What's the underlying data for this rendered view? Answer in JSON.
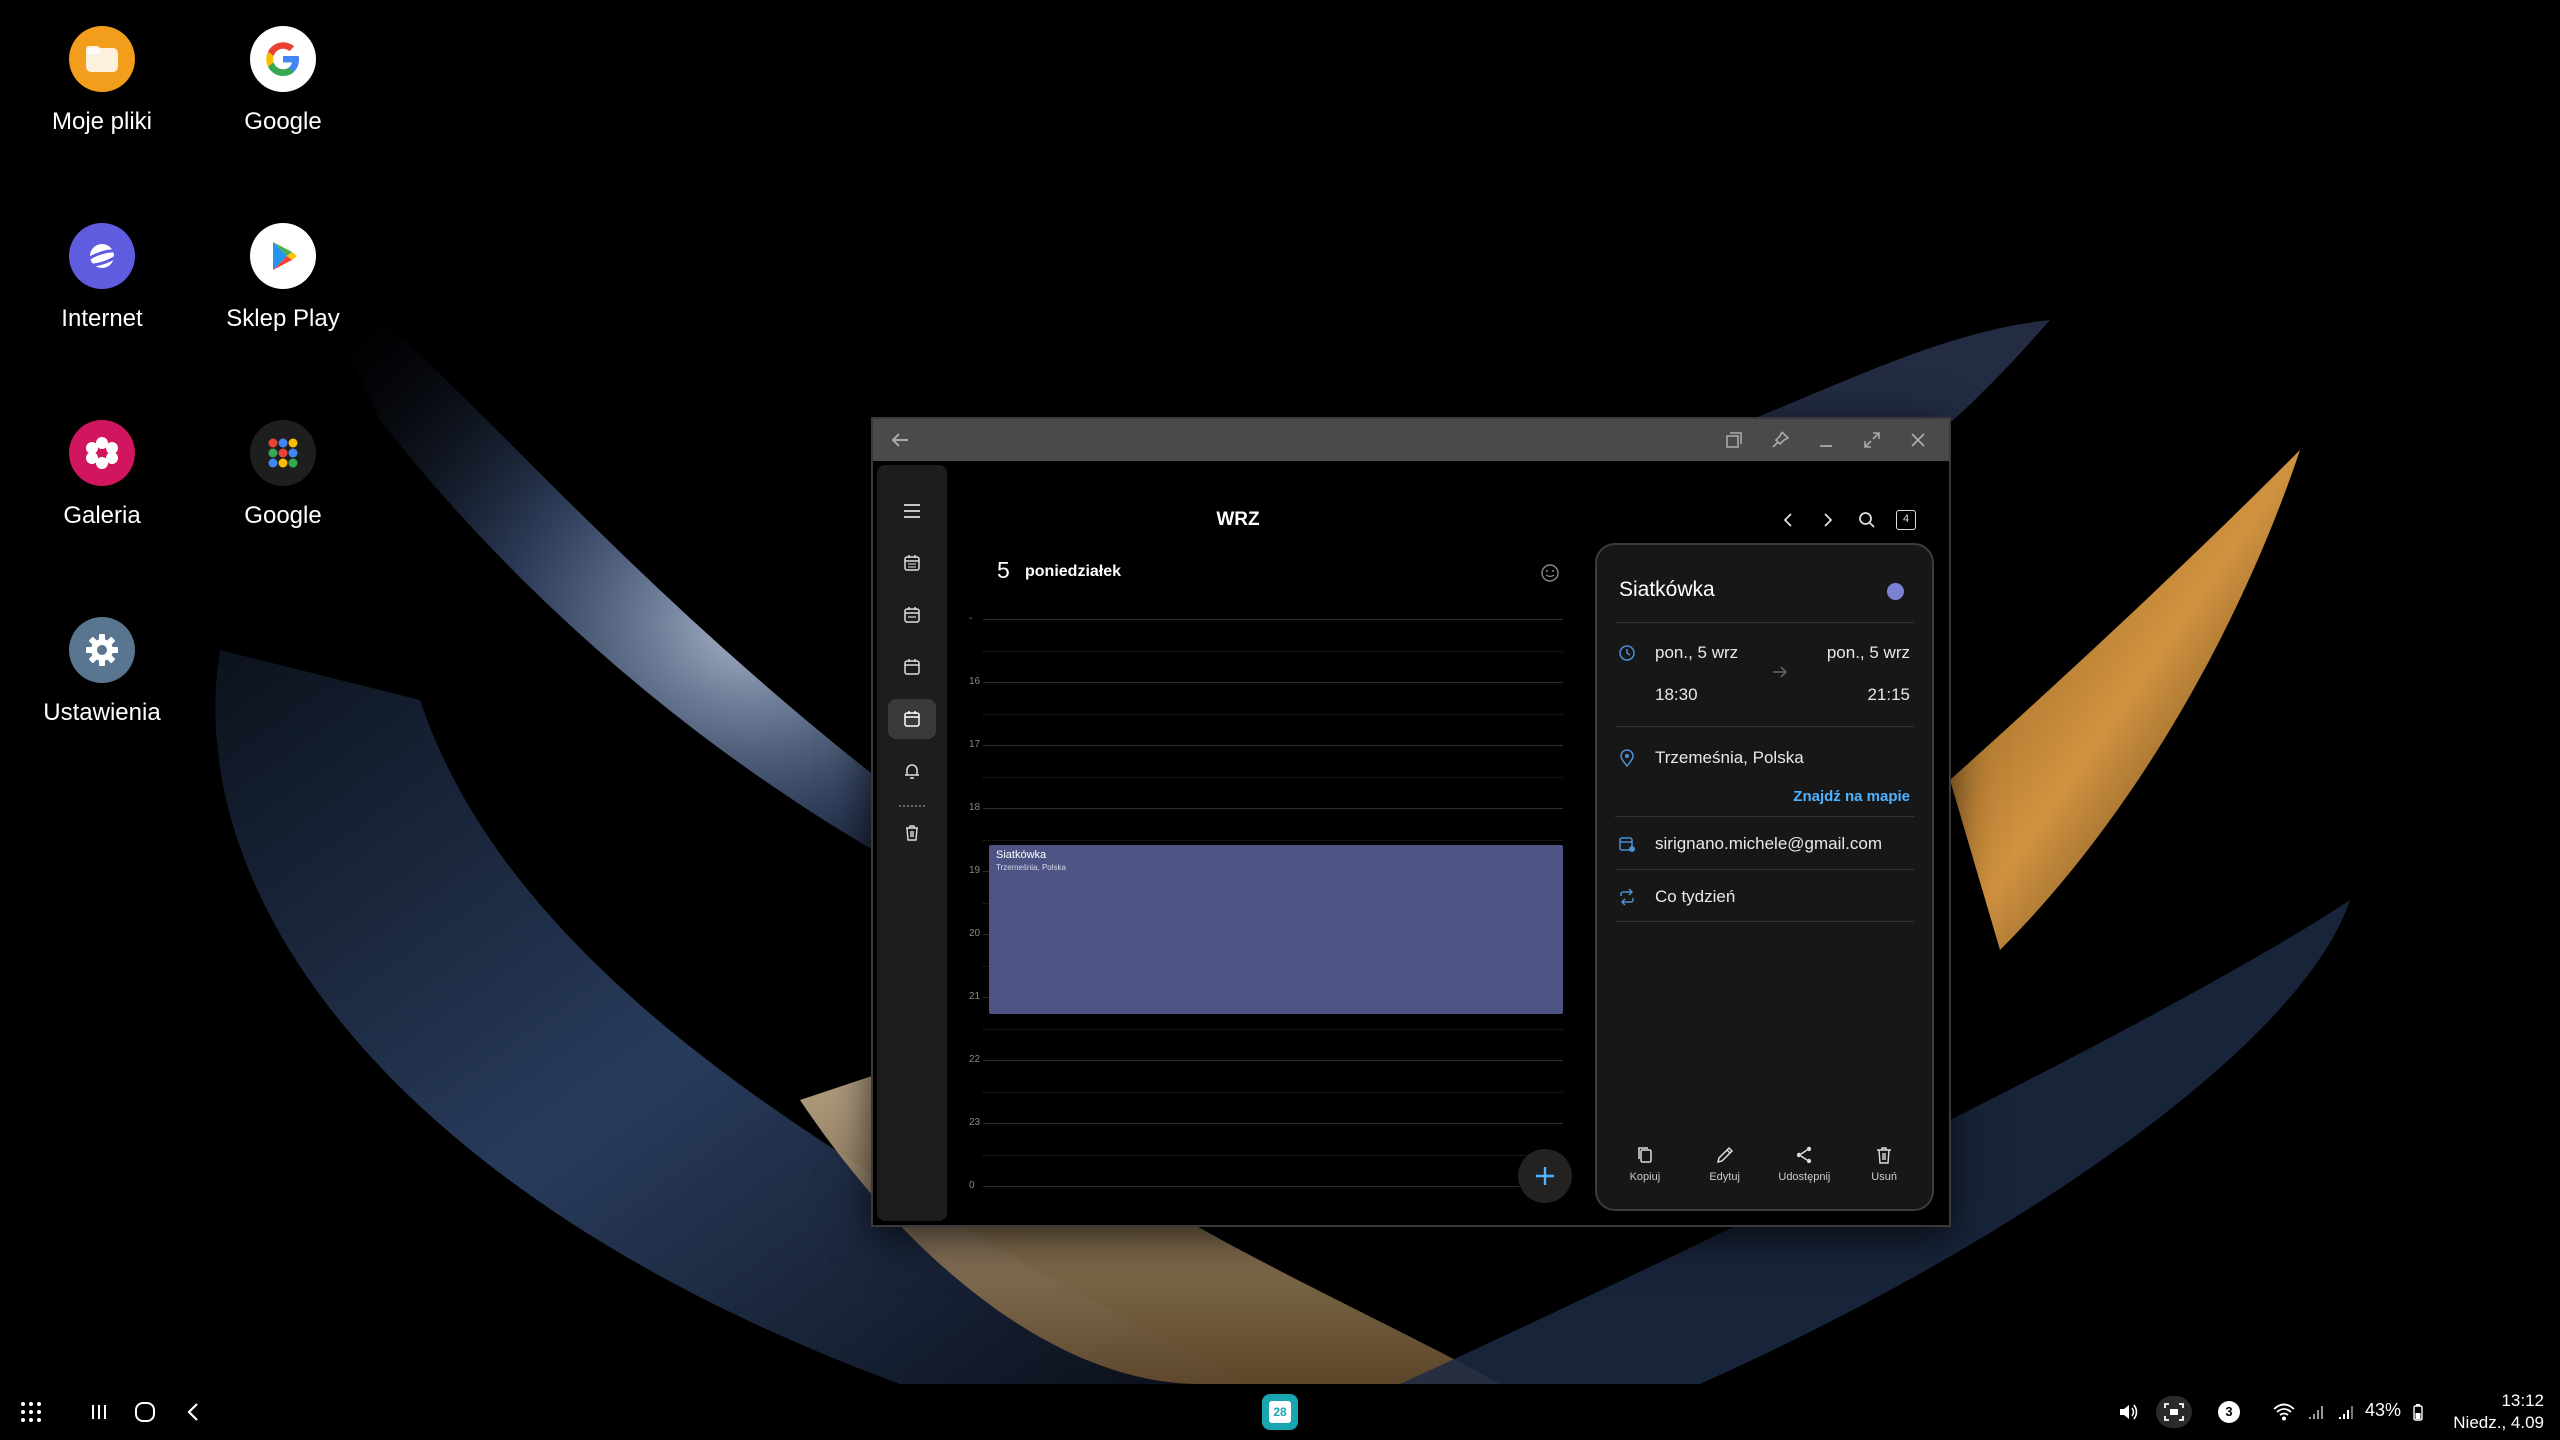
{
  "desktop": {
    "icons": [
      {
        "label": "Moje pliki",
        "icon": "folder-icon",
        "color": "#f29d1b"
      },
      {
        "label": "Google",
        "icon": "google-g-icon",
        "color": "#ffffff"
      },
      {
        "label": "Internet",
        "icon": "samsung-internet-icon",
        "color": "#5f5ce0"
      },
      {
        "label": "Sklep Play",
        "icon": "play-store-icon",
        "color": "#ffffff"
      },
      {
        "label": "Galeria",
        "icon": "gallery-flower-icon",
        "color": "#d1155e"
      },
      {
        "label": "Google",
        "icon": "google-apps-folder-icon",
        "color": "#1e1e1e"
      },
      {
        "label": "Ustawienia",
        "icon": "settings-gear-icon",
        "color": "#5a7590"
      }
    ]
  },
  "calendar": {
    "month_title": "WRZ",
    "badge_number": "4",
    "day_number": "5",
    "day_name": "poniedziałek",
    "hours": [
      "-",
      "16",
      "17",
      "18",
      "19",
      "20",
      "21",
      "22",
      "23",
      "0"
    ],
    "event": {
      "title": "Siatkówka",
      "location": "Trzemeśnia, Polska",
      "color": "#4d5382"
    }
  },
  "detail": {
    "title": "Siatkówka",
    "dot_color": "#7b82d4",
    "start_date": "pon., 5 wrz",
    "start_time": "18:30",
    "end_date": "pon., 5 wrz",
    "end_time": "21:15",
    "location": "Trzemeśnia, Polska",
    "map_link": "Znajdź na mapie",
    "account": "sirignano.michele@gmail.com",
    "repeat": "Co tydzień",
    "actions": [
      "Kopiuj",
      "Edytuj",
      "Udostępnij",
      "Usuń"
    ]
  },
  "taskbar": {
    "calendar_badge": "28",
    "notification_count": "3",
    "battery": "43%",
    "time": "13:12",
    "date": "Niedz., 4.09"
  }
}
